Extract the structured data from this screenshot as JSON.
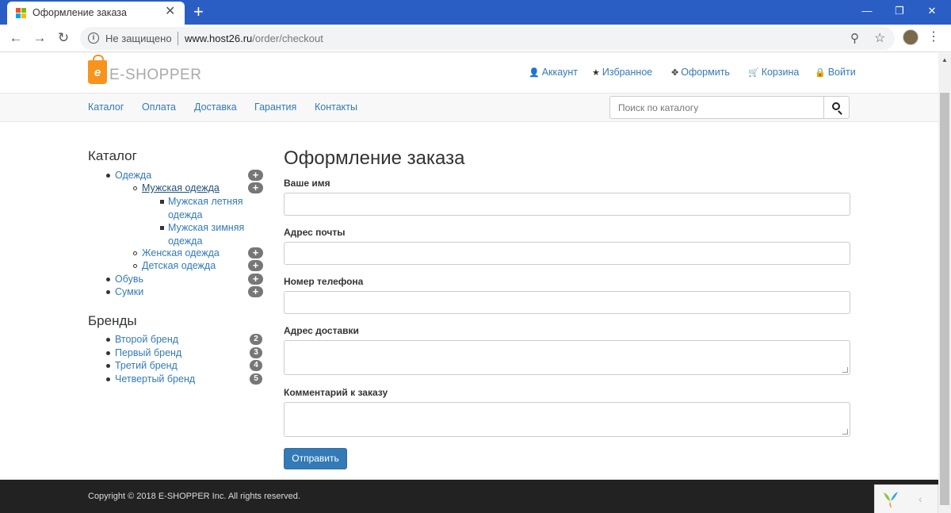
{
  "browser": {
    "tab_title": "Оформление заказа",
    "tab_close": "✕",
    "new_tab": "+",
    "security_label": "Не защищено",
    "url_host": "www.host26.ru",
    "url_path": "/order/checkout",
    "window_controls": {
      "minimize": "—",
      "maximize": "❐",
      "close": "✕"
    }
  },
  "header": {
    "logo_letter": "e",
    "logo_text": "E-SHOPPER",
    "links": [
      {
        "icon": "user-icon",
        "glyph": "👤",
        "label": "Аккаунт"
      },
      {
        "icon": "star-icon",
        "glyph": "★",
        "label": "Избранное"
      },
      {
        "icon": "crosshairs-icon",
        "glyph": "✥",
        "label": "Оформить"
      },
      {
        "icon": "cart-icon",
        "glyph": "🛒",
        "label": "Корзина"
      },
      {
        "icon": "lock-icon",
        "glyph": "🔒",
        "label": "Войти"
      }
    ]
  },
  "navbar": {
    "items": [
      "Каталог",
      "Оплата",
      "Доставка",
      "Гарантия",
      "Контакты"
    ],
    "search_placeholder": "Поиск по каталогу"
  },
  "sidebar": {
    "catalog_title": "Каталог",
    "categories": [
      {
        "label": "Одежда",
        "level": 1,
        "expandable": true
      },
      {
        "label": "Мужская одежда",
        "level": 2,
        "expandable": true,
        "active": true
      },
      {
        "label": "Мужская летняя одежда",
        "level": 3,
        "expandable": false
      },
      {
        "label": "Мужская зимняя одежда",
        "level": 3,
        "expandable": false
      },
      {
        "label": "Женская одежда",
        "level": 2,
        "expandable": true
      },
      {
        "label": "Детская одежда",
        "level": 2,
        "expandable": true
      },
      {
        "label": "Обувь",
        "level": 1,
        "expandable": true
      },
      {
        "label": "Сумки",
        "level": 1,
        "expandable": true
      }
    ],
    "brands_title": "Бренды",
    "brands": [
      {
        "label": "Второй бренд",
        "count": "2"
      },
      {
        "label": "Первый бренд",
        "count": "3"
      },
      {
        "label": "Третий бренд",
        "count": "4"
      },
      {
        "label": "Четвертый бренд",
        "count": "5"
      }
    ]
  },
  "form": {
    "title": "Оформление заказа",
    "fields": [
      {
        "label": "Ваше имя",
        "type": "input",
        "value": ""
      },
      {
        "label": "Адрес почты",
        "type": "input",
        "value": ""
      },
      {
        "label": "Номер телефона",
        "type": "input",
        "value": ""
      },
      {
        "label": "Адрес доставки",
        "type": "textarea",
        "value": ""
      },
      {
        "label": "Комментарий к заказу",
        "type": "textarea",
        "value": ""
      }
    ],
    "submit_label": "Отправить"
  },
  "footer": {
    "copyright": "Copyright © 2018 E-SHOPPER Inc. All rights reserved."
  },
  "colors": {
    "tabstrip": "#2a5ec5",
    "link": "#337ab7",
    "brand_orange": "#f7941e",
    "footer_bg": "#222222",
    "button_primary": "#337ab7"
  }
}
